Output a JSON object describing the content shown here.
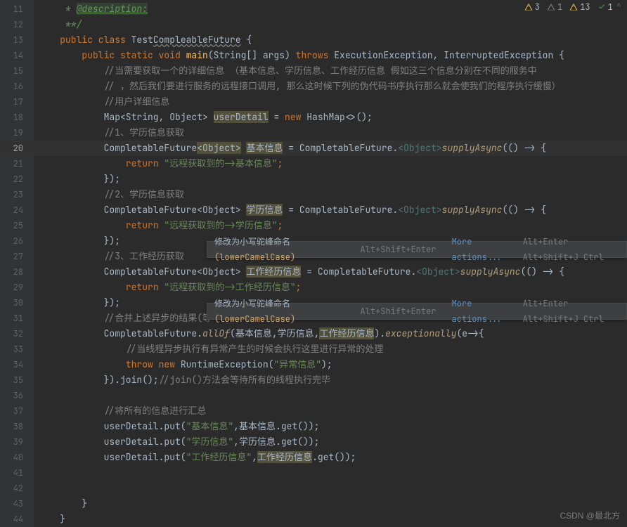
{
  "indicators": {
    "warn_major": "3",
    "warn_minor": "1",
    "weak": "13",
    "ok": "1"
  },
  "gutter": {
    "lines": [
      "11",
      "12",
      "13",
      "14",
      "15",
      "16",
      "17",
      "18",
      "19",
      "20",
      "21",
      "22",
      "23",
      "24",
      "25",
      "26",
      "27",
      "28",
      "29",
      "30",
      "31",
      "32",
      "33",
      "34",
      "35",
      "36",
      "37",
      "38",
      "39",
      "40",
      "41",
      "42",
      "43",
      "44"
    ]
  },
  "code": {
    "l11_doc": " * ",
    "l11_tag": "@description:",
    "l12": " **/",
    "l13_1": "public class ",
    "l13_2": "Test",
    "l13_3": "CompleableFuture",
    "l13_4": " {",
    "l14_1": "public static ",
    "l14_2": "void ",
    "l14_3": "main",
    "l14_4": "(String[] args) ",
    "l14_5": "throws ",
    "l14_6": "ExecutionException, InterruptedException {",
    "l15": "//当需要获取一个的详细信息 （基本信息、学历信息、工作经历信息 假如这三个信息分别在不同的服务中",
    "l16": "// ，然后我们要进行服务的远程接口调用, 那么这时候下列的伪代码书序执行那么就会使我们的程序执行缓慢）",
    "l17": "//用户详细信息",
    "l18_1": "Map<String, Object> ",
    "l18_2": "userDetail",
    "l18_3": " = ",
    "l18_4": "new ",
    "l18_5": "HashMap<>",
    "l18_6": "();",
    "l19": "//1、学历信息获取",
    "l20_1": "CompletableFuture",
    "l20_2": "<Object>",
    "l20_3": " ",
    "l20_4": "基本信息",
    "l20_5": " = CompletableFuture.",
    "l20_6": "<Object>",
    "l20_7": "supplyAsync",
    "l20_8": "(() -> {",
    "l21_1": "return ",
    "l21_2": "\"远程获取到的->基本信息\"",
    "l21_3": ";",
    "l22": "});",
    "l23": "//2、学历信息获取",
    "l24_1": "CompletableFuture<Object> ",
    "l24_2": "学历信息",
    "l24_3": " = CompletableFuture.",
    "l24_6": "<Object>",
    "l24_7": "supplyAsync",
    "l24_8": "(() -> {",
    "l25_1": "return ",
    "l25_2": "\"远程获取到的->学历信息\"",
    "l25_3": ";",
    "l26": "});",
    "l27": "//3、工作经历获取",
    "l28_1": "CompletableFuture<Object> ",
    "l28_2": "工作经历信息",
    "l28_3": " = CompletableFuture.",
    "l28_6": "<Object>",
    "l28_7": "supplyAsync",
    "l28_8": "(() -> {",
    "l29_1": "return ",
    "l29_2": "\"远程获取到的->工作经历信息\"",
    "l29_3": ";",
    "l30": "});",
    "l31": "//合并上述异步的结果(等",
    "l32_1": "CompletableFuture.",
    "l32_2": "allOf",
    "l32_3": "(基本信息,学历信息,",
    "l32_4": "工作经历信息",
    "l32_5": ").",
    "l32_6": "exceptionally",
    "l32_7": "(e->{",
    "l33": "//当线程异步执行有异常产生的时候会执行这里进行异常的处理",
    "l34_1": "throw new ",
    "l34_2": "RuntimeException(",
    "l34_3": "\"异常信息\"",
    "l34_4": ");",
    "l35_1": "}).join();",
    "l35_2": "//join()方法会等待所有的线程执行完毕",
    "l37": "//将所有的信息进行汇总",
    "l38_1": "userDetail.put(",
    "l38_2": "\"基本信息\"",
    "l38_3": ",基本信息.get());",
    "l39_1": "userDetail.put(",
    "l39_2": "\"学历信息\"",
    "l39_3": ",学历信息.get());",
    "l40_1": "userDetail.put(",
    "l40_2": "\"工作经历信息\"",
    "l40_3": ",",
    "l40_4": "工作经历信息",
    "l40_5": ".get());",
    "l43": "}",
    "l44": "}"
  },
  "hints": {
    "msg_prefix": "修改为小写驼峰命名 ",
    "msg_suffix": "(lowerCamelCase)",
    "shortcut1": "Alt+Shift+Enter",
    "more": "More actions...",
    "shortcut2": "Alt+Enter Alt+Shift+J Ctrl"
  },
  "watermark": "CSDN @最北方"
}
